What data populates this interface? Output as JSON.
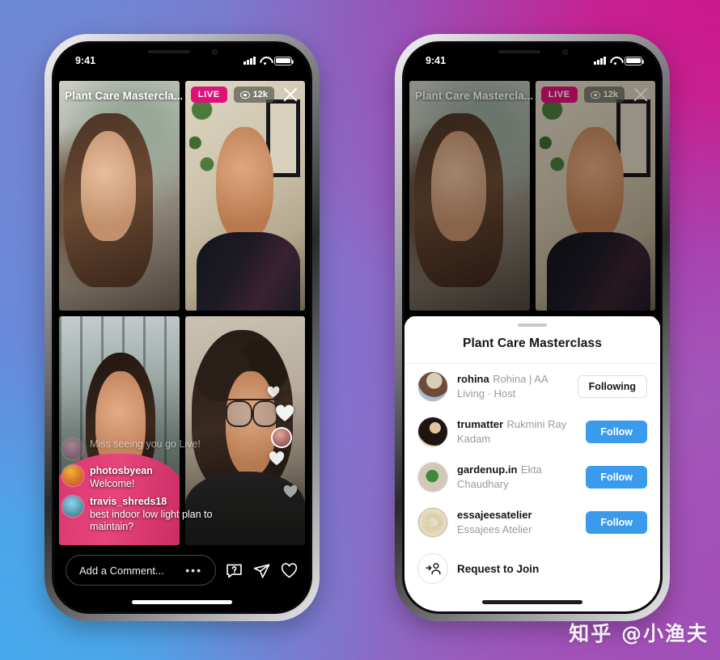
{
  "watermark": "知乎 @小渔夫",
  "status_bar": {
    "time": "9:41",
    "signal_icon": "cellular-bars-icon",
    "wifi_icon": "wifi-icon",
    "battery_icon": "battery-icon"
  },
  "left_phone": {
    "live": {
      "title": "Plant Care Mastercla...",
      "live_badge": "LIVE",
      "viewer_count": "12k",
      "viewer_icon": "eye-icon",
      "close_icon": "close-icon"
    },
    "comments": [
      {
        "user": "",
        "body": "Miss seeing you go Live!",
        "faded": true
      },
      {
        "user": "photosbyean",
        "body": "Welcome!",
        "faded": false
      },
      {
        "user": "travis_shreds18",
        "body": "best indoor low light plan to maintain?",
        "faded": false
      }
    ],
    "bottom_bar": {
      "comment_placeholder": "Add a Comment...",
      "more_icon": "ellipsis-icon",
      "question_icon": "question-bubble-icon",
      "share_icon": "paper-plane-icon",
      "like_icon": "heart-icon"
    }
  },
  "right_phone": {
    "live": {
      "title": "Plant Care Mastercla...",
      "live_badge": "LIVE",
      "viewer_count": "12k",
      "viewer_icon": "eye-icon",
      "close_icon": "close-icon"
    },
    "sheet": {
      "title": "Plant Care Masterclass",
      "users": [
        {
          "username": "rohina",
          "fullname": "Rohina | AA Living · Host",
          "action": "Following",
          "action_style": "outline"
        },
        {
          "username": "trumatter",
          "fullname": "Rukmini Ray Kadam",
          "action": "Follow",
          "action_style": "primary"
        },
        {
          "username": "gardenup.in",
          "fullname": "Ekta Chaudhary",
          "action": "Follow",
          "action_style": "primary"
        },
        {
          "username": "essajeesatelier",
          "fullname": "Essajees Atelier",
          "action": "Follow",
          "action_style": "primary"
        }
      ],
      "request_row": {
        "label": "Request to Join",
        "icon": "add-person-icon"
      }
    }
  },
  "colors": {
    "live_badge": "#dd1177",
    "follow_button": "#3a9bed",
    "sheet_background": "#ffffff"
  }
}
